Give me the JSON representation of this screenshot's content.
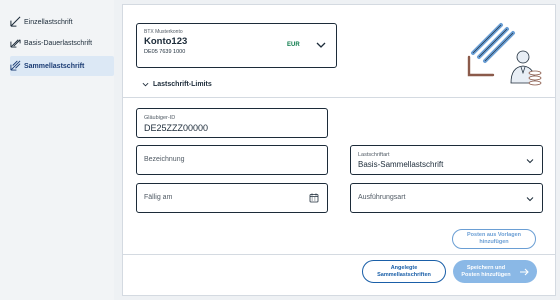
{
  "sidebar": {
    "items": [
      {
        "label": "Einzellastschrift",
        "icon": "single-debit-icon",
        "active": false
      },
      {
        "label": "Basis-Dauerlastschrift",
        "icon": "recurring-debit-icon",
        "active": false
      },
      {
        "label": "Sammellastschrift",
        "icon": "bulk-debit-icon",
        "active": true
      }
    ]
  },
  "account": {
    "label": "BTX Musterkonto",
    "name": "Konto123",
    "iban": "DE05 7639 1000",
    "currency": "EUR"
  },
  "limits": {
    "label": "Lastschrift-Limits"
  },
  "form": {
    "creditor_id": {
      "label": "Gläubiger-ID",
      "value": "DE25ZZZ00000"
    },
    "designation": {
      "placeholder": "Bezeichnung"
    },
    "debit_type": {
      "label": "Lastschriftart",
      "value": "Basis-Sammellastschrift"
    },
    "due_date": {
      "placeholder": "Fällig am"
    },
    "execution_type": {
      "placeholder": "Ausführungsart"
    }
  },
  "buttons": {
    "add_from_templates": [
      "Posten aus Vorlagen",
      "hinzufügen"
    ],
    "created_bulk": [
      "Angelegte",
      "Sammellastschriften"
    ],
    "save_add": [
      "Speichern und",
      "Posten hinzufügen"
    ]
  },
  "colors": {
    "accent": "#1a5fa8",
    "accent_light": "#8ab8e6",
    "currency": "#0a7a4a"
  }
}
